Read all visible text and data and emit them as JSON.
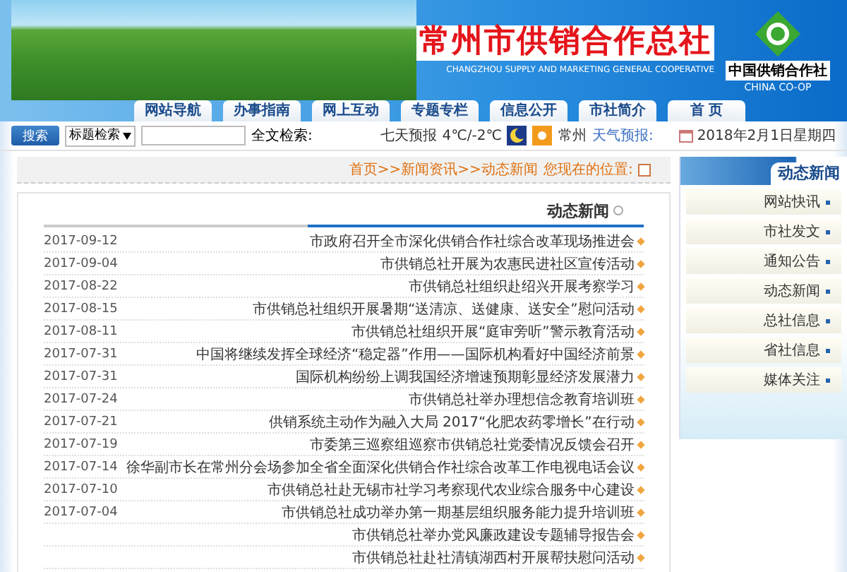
{
  "header": {
    "logo_text": "中国供销合作社",
    "logo_subtext": "CHINA CO-OP",
    "title": "常州市供销合作总社",
    "subtitle": "CHANGZHOU SUPPLY AND MARKETING GENERAL COOPERATIVE"
  },
  "nav": [
    {
      "label": "网站导航"
    },
    {
      "label": "办事指南"
    },
    {
      "label": "网上互动"
    },
    {
      "label": "专题专栏"
    },
    {
      "label": "信息公开"
    },
    {
      "label": "市社简介"
    },
    {
      "label": "首 页"
    }
  ],
  "info_bar": {
    "date": "2018年2月1日星期四",
    "weather_label": "天气预报:",
    "city": "常州",
    "temperature": "4℃/-2℃",
    "forecast_link": "七天预报",
    "search_label": "全文检索:",
    "select_value": "标题检索",
    "search_button": "搜索"
  },
  "breadcrumb": {
    "label": "您现在的位置:",
    "path": "首页>>新闻资讯>>动态新闻"
  },
  "sidebar": {
    "title": "动态新闻",
    "items": [
      {
        "label": "网站快讯"
      },
      {
        "label": "市社发文"
      },
      {
        "label": "通知公告"
      },
      {
        "label": "动态新闻"
      },
      {
        "label": "总社信息"
      },
      {
        "label": "省社信息"
      },
      {
        "label": "媒体关注"
      }
    ]
  },
  "news": {
    "title": "动态新闻",
    "items": [
      {
        "title": "市政府召开全市深化供销合作社综合改革现场推进会",
        "date": "2017-09-12"
      },
      {
        "title": "市供销总社开展为农惠民进社区宣传活动",
        "date": "2017-09-04"
      },
      {
        "title": "市供销总社组织赴绍兴开展考察学习",
        "date": "2017-08-22"
      },
      {
        "title": "市供销总社组织开展暑期“送清凉、送健康、送安全”慰问活动",
        "date": "2017-08-15"
      },
      {
        "title": "市供销总社组织开展“庭审旁听”警示教育活动",
        "date": "2017-08-11"
      },
      {
        "title": "中国将继续发挥全球经济“稳定器”作用——国际机构看好中国经济前景",
        "date": "2017-07-31"
      },
      {
        "title": "国际机构纷纷上调我国经济增速预期彰显经济发展潜力",
        "date": "2017-07-31"
      },
      {
        "title": "市供销总社举办理想信念教育培训班",
        "date": "2017-07-24"
      },
      {
        "title": "供销系统主动作为融入大局 2017“化肥农药零增长”在行动",
        "date": "2017-07-21"
      },
      {
        "title": "市委第三巡察组巡察市供销总社党委情况反馈会召开",
        "date": "2017-07-19"
      },
      {
        "title": "徐华副市长在常州分会场参加全省全面深化供销合作社综合改革工作电视电话会议",
        "date": "2017-07-14"
      },
      {
        "title": "市供销总社赴无锡市社学习考察现代农业综合服务中心建设",
        "date": "2017-07-10"
      },
      {
        "title": "市供销总社成功举办第一期基层组织服务能力提升培训班",
        "date": "2017-07-04"
      },
      {
        "title": "市供销总社举办党风廉政建设专题辅导报告会"
      },
      {
        "title": "市供销总社赴社清镇湖西村开展帮扶慰问活动"
      }
    ]
  }
}
